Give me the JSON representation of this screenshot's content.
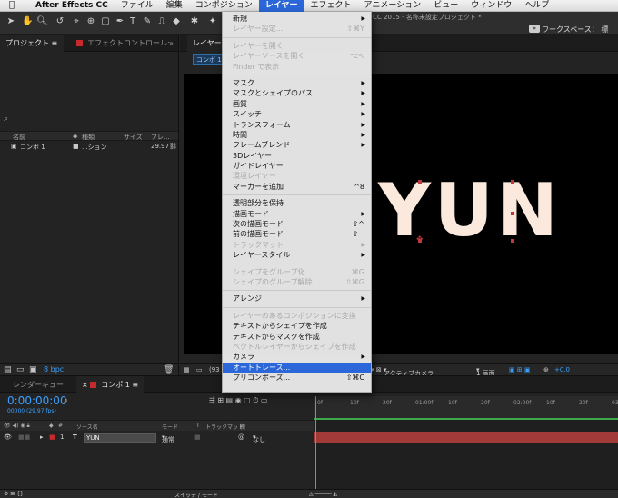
{
  "menubar": {
    "items": [
      "After Effects CC",
      "ファイル",
      "編集",
      "コンポジション",
      "レイヤー",
      "エフェクト",
      "アニメーション",
      "ビュー",
      "ウィンドウ",
      "ヘルプ"
    ],
    "active": "レイヤー"
  },
  "toolbar": {
    "title": "c CC 2015 - 名称未設定プロジェクト *",
    "workspace_label": "ワークスペース：",
    "workspace_value": "標"
  },
  "project_panel": {
    "tab_project": "プロジェクト",
    "tab_effects": "エフェクトコントロール:",
    "columns": [
      "名前",
      "種類",
      "サイズ",
      "フレ..."
    ],
    "items": [
      {
        "name": "コンポ 1",
        "type": "...ション",
        "fps": "29.97"
      }
    ],
    "bpc": "8 bpc"
  },
  "viewer": {
    "tab_label": "レイヤー",
    "comp_button": "コンポ 1",
    "text_layer": "YUN",
    "zoom": "(93",
    "camera": "アクティブカメラ",
    "view": "1 画面",
    "exposure": "+0.0"
  },
  "timeline": {
    "tab_render": "レンダーキュー",
    "tab_comp": "コンポ 1",
    "timecode": "0:00:00:00",
    "fps": "00000 (29.97 fps)",
    "ruler": [
      "0f",
      "10f",
      "20f",
      "01:00f",
      "10f",
      "20f",
      "02:00f",
      "10f",
      "20f",
      "03:00f"
    ],
    "columns": {
      "source": "ソース名",
      "mode": "モード",
      "t": "T",
      "trkmat": "トラックマット",
      "parent": "親"
    },
    "layer": {
      "num": "1",
      "name": "YUN",
      "mode": "通常",
      "parent": "なし"
    },
    "footer": "スイッチ / モード"
  },
  "layer_menu": {
    "items": [
      {
        "label": "新規",
        "submenu": true,
        "enabled": true
      },
      {
        "label": "レイヤー設定...",
        "shortcut": "⇧⌘Y",
        "enabled": false
      },
      {
        "sep": true
      },
      {
        "label": "レイヤーを開く",
        "enabled": false
      },
      {
        "label": "レイヤーソースを開く",
        "shortcut": "⌥↖",
        "enabled": false
      },
      {
        "label": "Finder で表示",
        "enabled": false
      },
      {
        "sep": true
      },
      {
        "label": "マスク",
        "submenu": true,
        "enabled": true
      },
      {
        "label": "マスクとシェイプのパス",
        "submenu": true,
        "enabled": true
      },
      {
        "label": "画質",
        "submenu": true,
        "enabled": true
      },
      {
        "label": "スイッチ",
        "submenu": true,
        "enabled": true
      },
      {
        "label": "トランスフォーム",
        "submenu": true,
        "enabled": true
      },
      {
        "label": "時間",
        "submenu": true,
        "enabled": true
      },
      {
        "label": "フレームブレンド",
        "submenu": true,
        "enabled": true
      },
      {
        "label": "3Dレイヤー",
        "enabled": true
      },
      {
        "label": "ガイドレイヤー",
        "enabled": true
      },
      {
        "label": "環境レイヤー",
        "enabled": false
      },
      {
        "label": "マーカーを追加",
        "shortcut": "^8",
        "enabled": true
      },
      {
        "sep": true
      },
      {
        "label": "透明部分を保持",
        "enabled": true
      },
      {
        "label": "描画モード",
        "submenu": true,
        "enabled": true
      },
      {
        "label": "次の描画モード",
        "shortcut": "⇧^",
        "enabled": true
      },
      {
        "label": "前の描画モード",
        "shortcut": "⇧−",
        "enabled": true
      },
      {
        "label": "トラックマット",
        "submenu": true,
        "enabled": false
      },
      {
        "label": "レイヤースタイル",
        "submenu": true,
        "enabled": true
      },
      {
        "sep": true
      },
      {
        "label": "シェイプをグループ化",
        "shortcut": "⌘G",
        "enabled": false
      },
      {
        "label": "シェイプのグループ解除",
        "shortcut": "⇧⌘G",
        "enabled": false
      },
      {
        "sep": true
      },
      {
        "label": "アレンジ",
        "submenu": true,
        "enabled": true
      },
      {
        "sep": true
      },
      {
        "label": "レイヤーのあるコンポジションに変換",
        "enabled": false
      },
      {
        "label": "テキストからシェイプを作成",
        "enabled": true
      },
      {
        "label": "テキストからマスクを作成",
        "enabled": true
      },
      {
        "label": "ベクトルレイヤーからシェイプを作成",
        "enabled": false
      },
      {
        "label": "カメラ",
        "submenu": true,
        "enabled": true
      },
      {
        "label": "オートトレース...",
        "enabled": true,
        "selected": true
      },
      {
        "label": "プリコンポーズ...",
        "shortcut": "⇧⌘C",
        "enabled": true
      }
    ]
  },
  "colors": {
    "accent": "#2b67d8",
    "timecode": "#3aa0ff",
    "layer_bar": "#a33a3a",
    "text_layer": "#fbe9dd"
  }
}
